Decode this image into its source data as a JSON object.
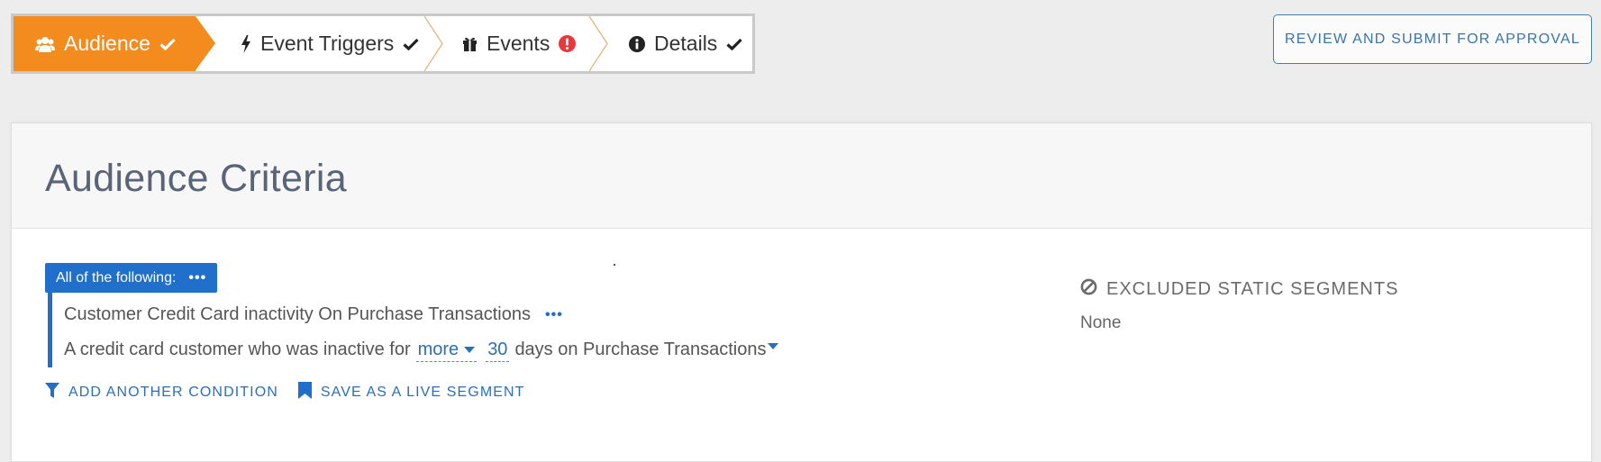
{
  "wizard": {
    "steps": [
      {
        "label": "Audience",
        "icon": "users-icon",
        "status": "check",
        "active": true
      },
      {
        "label": "Event Triggers",
        "icon": "bolt-icon",
        "status": "check",
        "active": false
      },
      {
        "label": "Events",
        "icon": "gift-icon",
        "status": "error",
        "active": false
      },
      {
        "label": "Details",
        "icon": "info-icon",
        "status": "check",
        "active": false
      }
    ],
    "colors": {
      "active": "#f38b1f",
      "error": "#e8383d"
    }
  },
  "header": {
    "review_button": "REVIEW AND SUBMIT FOR APPROVAL"
  },
  "card": {
    "title": "Audience Criteria",
    "group_label": "All of the following:",
    "condition": {
      "title": "Customer Credit Card inactivity On Purchase Transactions",
      "desc_prefix": "A credit card customer who was inactive for",
      "comparator": "more",
      "days_value": "30",
      "desc_suffix": "days on Purchase Transactions"
    },
    "actions": {
      "add_condition": "ADD ANOTHER CONDITION",
      "save_segment": "SAVE AS A LIVE SEGMENT"
    },
    "excluded": {
      "heading": "EXCLUDED STATIC SEGMENTS",
      "value": "None"
    }
  },
  "accent_color": "#1f6fcb"
}
